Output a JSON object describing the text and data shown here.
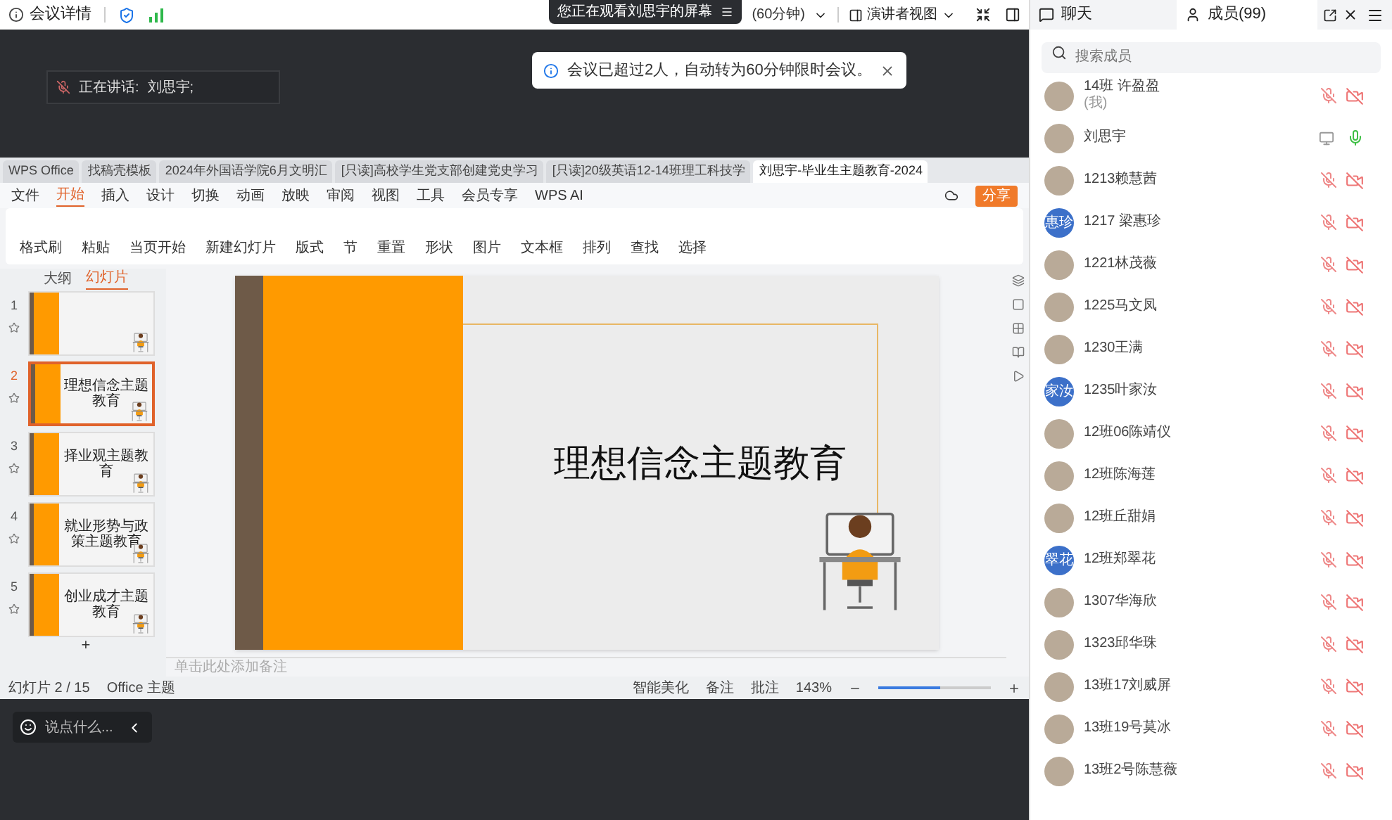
{
  "top_bar": {
    "meeting_details": "会议详情",
    "timer": "(60分钟)",
    "view_mode": "演讲者视图"
  },
  "watching_banner": "您正在观看刘思宇的屏幕",
  "speaking": {
    "label": "正在讲话:",
    "name": "刘思宇;"
  },
  "toast": "会议已超过2人，自动转为60分钟限时会议。",
  "shared_window": {
    "tabs": [
      {
        "label": "WPS Office",
        "selected": false
      },
      {
        "label": "找稿壳模板",
        "selected": false
      },
      {
        "label": "2024年外国语学院6月文明汇",
        "selected": false
      },
      {
        "label": "[只读]高校学生党支部创建党史学习",
        "selected": false
      },
      {
        "label": "[只读]20级英语12-14班理工科技学",
        "selected": false
      },
      {
        "label": "刘思宇-毕业生主题教育-2024",
        "selected": true
      }
    ],
    "menu": [
      {
        "label": "文件",
        "selected": false
      },
      {
        "label": "开始",
        "selected": true
      },
      {
        "label": "插入",
        "selected": false
      },
      {
        "label": "设计",
        "selected": false
      },
      {
        "label": "切换",
        "selected": false
      },
      {
        "label": "动画",
        "selected": false
      },
      {
        "label": "放映",
        "selected": false
      },
      {
        "label": "审阅",
        "selected": false
      },
      {
        "label": "视图",
        "selected": false
      },
      {
        "label": "工具",
        "selected": false
      },
      {
        "label": "会员专享",
        "selected": false
      },
      {
        "label": "WPS AI",
        "selected": false
      }
    ],
    "share_button": "分享",
    "ribbon": [
      "格式刷",
      "粘贴",
      "当页开始",
      "新建幻灯片",
      "版式",
      "节",
      "重置",
      "形状",
      "图片",
      "文本框",
      "排列",
      "查找",
      "选择"
    ],
    "panel_tabs": [
      {
        "label": "大纲",
        "selected": false
      },
      {
        "label": "幻灯片",
        "selected": true
      }
    ],
    "slides": [
      {
        "number": "1",
        "selected": false
      },
      {
        "number": "2",
        "title": "理想信念主题教育",
        "selected": true
      },
      {
        "number": "3",
        "title": "择业观主题教育",
        "selected": false
      },
      {
        "number": "4",
        "title": "就业形势与政策主题教育",
        "selected": false
      },
      {
        "number": "5",
        "title": "创业成才主题教育",
        "selected": false
      }
    ],
    "add_slide": "+",
    "slide_title": "理想信念主题教育",
    "notes_placeholder": "单击此处添加备注",
    "status_bar": {
      "slide_count": "幻灯片 2 / 15",
      "theme": "Office 主题",
      "items": [
        "智能美化",
        "备注",
        "批注"
      ],
      "zoom": "143%",
      "zoom_slider": {
        "level": 0.55
      }
    }
  },
  "chat_input": {
    "placeholder": "说点什么..."
  },
  "panel_tabs": [
    {
      "label": "聊天",
      "selected": false
    },
    {
      "label": "成员(99)",
      "selected": true
    }
  ],
  "member_search": {
    "placeholder": "搜索成员"
  },
  "members": [
    {
      "name": "14班 许盈盈",
      "note": "(我)",
      "avatar": {
        "kind": "photo"
      },
      "mic_on": false,
      "sharing": false
    },
    {
      "name": "刘思宇",
      "avatar": {
        "kind": "photo"
      },
      "mic_on": true,
      "sharing": true
    },
    {
      "name": "1213赖慧茜",
      "avatar": {
        "kind": "photo"
      },
      "mic_on": false,
      "sharing": false
    },
    {
      "name": "1217 梁惠珍",
      "avatar": {
        "kind": "text",
        "text": "惠珍"
      },
      "mic_on": false,
      "sharing": false
    },
    {
      "name": "1221林茂薇",
      "avatar": {
        "kind": "photo"
      },
      "mic_on": false,
      "sharing": false
    },
    {
      "name": "1225马文凤",
      "avatar": {
        "kind": "photo"
      },
      "mic_on": false,
      "sharing": false
    },
    {
      "name": "1230王满",
      "avatar": {
        "kind": "photo"
      },
      "mic_on": false,
      "sharing": false
    },
    {
      "name": "1235叶家汝",
      "avatar": {
        "kind": "text",
        "text": "家汝"
      },
      "mic_on": false,
      "sharing": false
    },
    {
      "name": "12班06陈靖仪",
      "avatar": {
        "kind": "photo"
      },
      "mic_on": false,
      "sharing": false
    },
    {
      "name": "12班陈海莲",
      "avatar": {
        "kind": "photo"
      },
      "mic_on": false,
      "sharing": false
    },
    {
      "name": "12班丘甜娟",
      "avatar": {
        "kind": "photo"
      },
      "mic_on": false,
      "sharing": false
    },
    {
      "name": "12班郑翠花",
      "avatar": {
        "kind": "text",
        "text": "翠花"
      },
      "mic_on": false,
      "sharing": false
    },
    {
      "name": "1307华海欣",
      "avatar": {
        "kind": "photo"
      },
      "mic_on": false,
      "sharing": false
    },
    {
      "name": "1323邱华珠",
      "avatar": {
        "kind": "photo"
      },
      "mic_on": false,
      "sharing": false
    },
    {
      "name": "13班17刘威屏",
      "avatar": {
        "kind": "photo"
      },
      "mic_on": false,
      "sharing": false
    },
    {
      "name": "13班19号莫冰",
      "avatar": {
        "kind": "photo"
      },
      "mic_on": false,
      "sharing": false
    },
    {
      "name": "13班2号陈慧薇",
      "avatar": {
        "kind": "photo"
      },
      "mic_on": false,
      "sharing": false
    }
  ]
}
